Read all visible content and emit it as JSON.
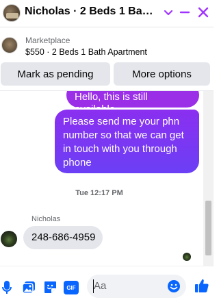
{
  "header": {
    "title": "Nicholas · 2 Beds 1 Bath A...",
    "avatar_icon": "house-photo-avatar",
    "chevron_icon": "chevron-down-icon",
    "minimize_icon": "minimize-icon",
    "close_icon": "close-icon",
    "accent": "#a033ff"
  },
  "marketplace": {
    "label": "Marketplace",
    "item": "$550 · 2 Beds 1 Bath Apartment"
  },
  "actions": {
    "pending_label": "Mark as pending",
    "more_label": "More options"
  },
  "messages": {
    "outgoing_partial": "Hello, this is still available",
    "outgoing_main": "Please send me your phn number so that we can get in touch with you through phone",
    "timestamp": "Tue 12:17 PM",
    "sender": "Nicholas",
    "incoming": "248-686-4959"
  },
  "composer": {
    "placeholder": "Aa",
    "icons": [
      "microphone-icon",
      "photo-icon",
      "sticker-icon",
      "gif-icon",
      "emoji-icon",
      "like-icon"
    ],
    "gif_label": "GIF"
  }
}
